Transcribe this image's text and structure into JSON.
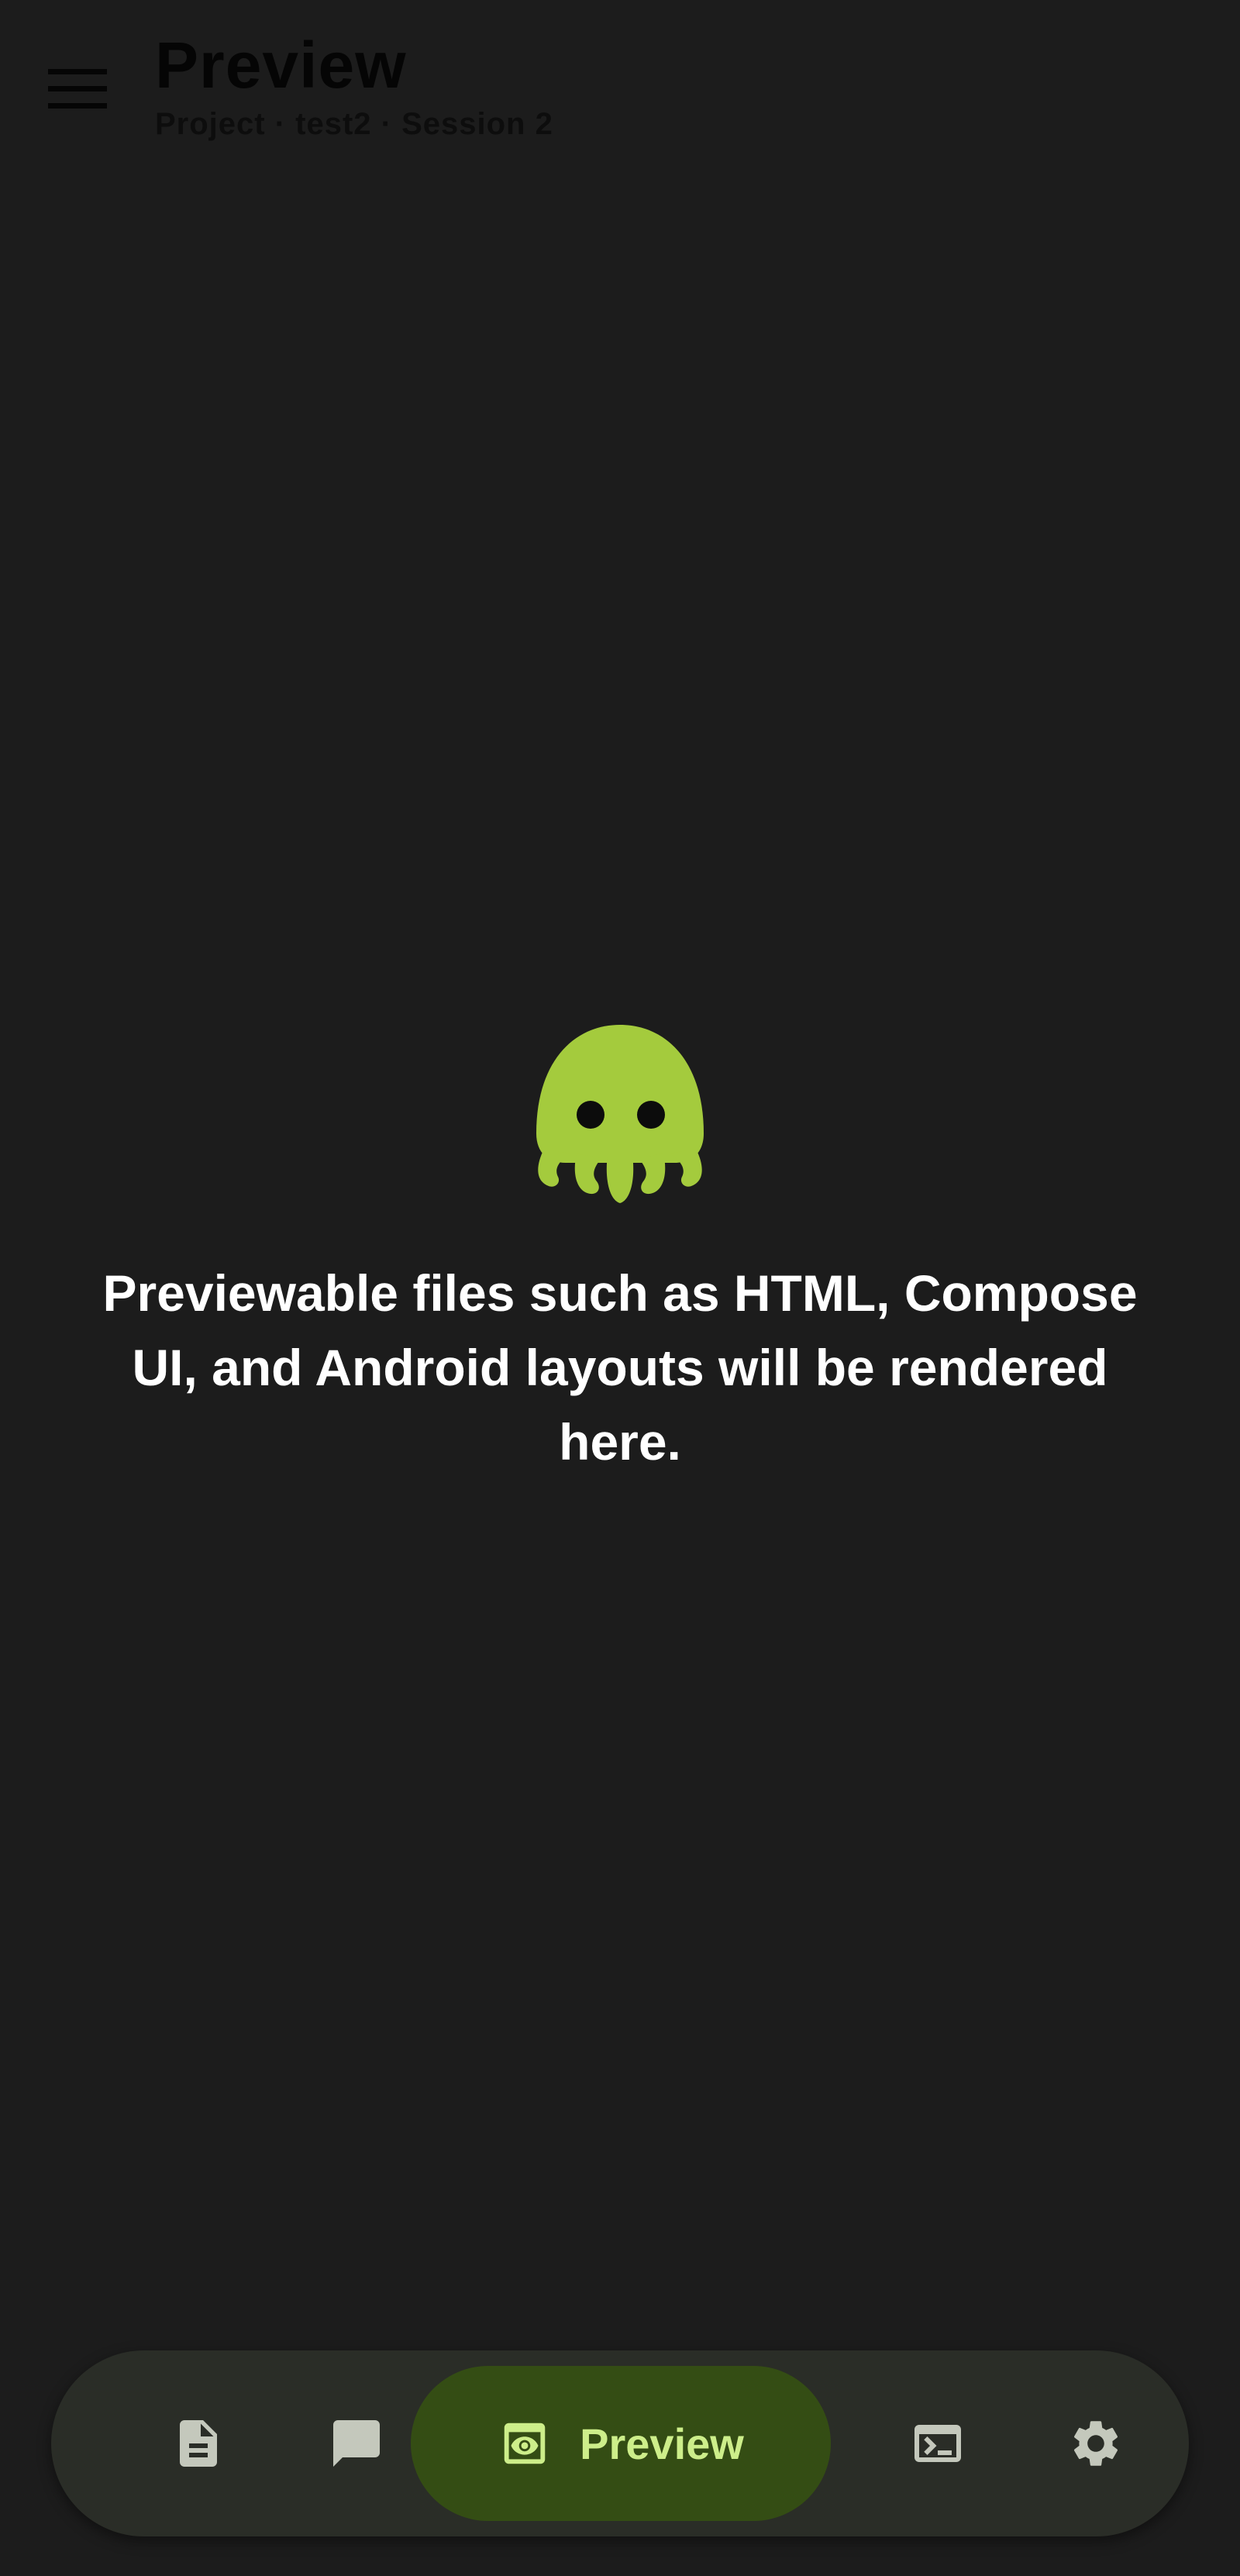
{
  "header": {
    "title": "Preview",
    "subtitle": "Project · test2 · Session 2",
    "menu_icon": "hamburger-menu-icon"
  },
  "empty_state": {
    "icon": "octopus-mascot-icon",
    "message": "Previewable files such as HTML, Compose UI, and Android layouts will be rendered here."
  },
  "bottom_nav": {
    "items": [
      {
        "icon": "document-icon",
        "label": "",
        "active": false
      },
      {
        "icon": "chat-icon",
        "label": "",
        "active": false
      },
      {
        "icon": "preview-eye-icon",
        "label": "Preview",
        "active": true
      },
      {
        "icon": "terminal-icon",
        "label": "",
        "active": false
      },
      {
        "icon": "gear-icon",
        "label": "",
        "active": false
      }
    ]
  },
  "colors": {
    "background": "#1c1c1c",
    "mascot": "#a4cb3d",
    "nav_background": "#2a2d27",
    "nav_active_background": "#344d14",
    "nav_active_foreground": "#cdee8a",
    "nav_inactive_icon": "#c4c8bc"
  }
}
